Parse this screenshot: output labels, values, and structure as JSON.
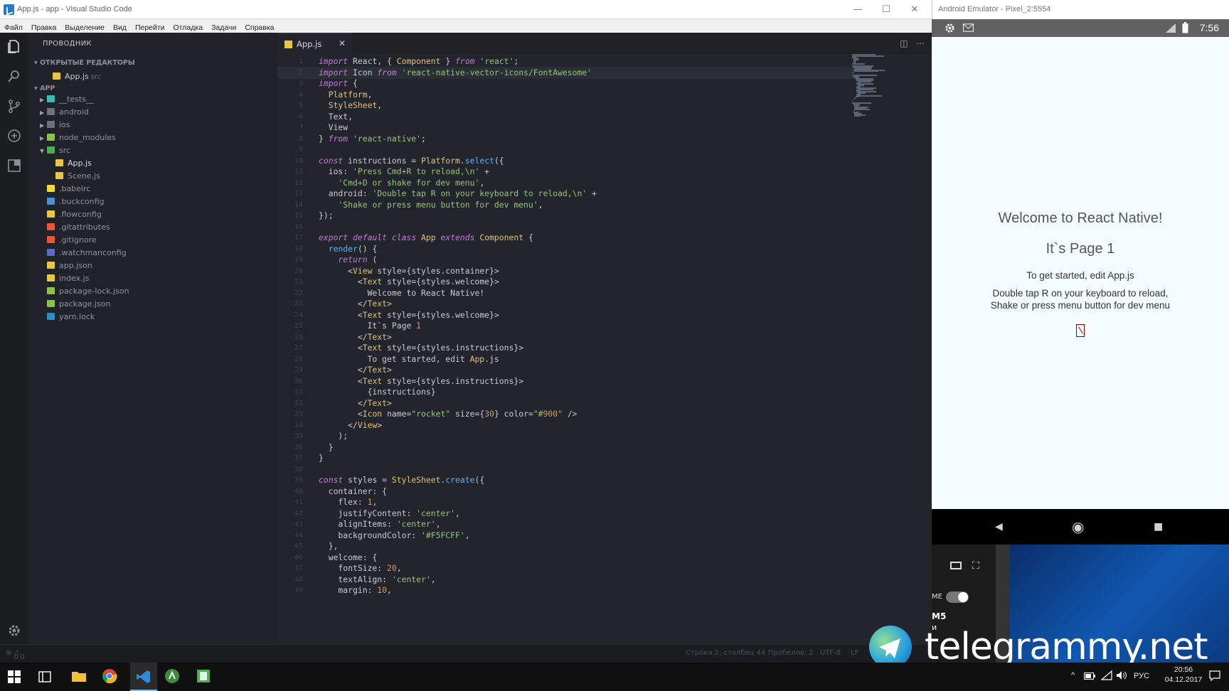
{
  "vscode": {
    "window_title": "App.js - app - Visual Studio Code",
    "menu": [
      "Файл",
      "Правка",
      "Выделение",
      "Вид",
      "Перейти",
      "Отладка",
      "Задачи",
      "Справка"
    ],
    "explorer_title": "ПРОВОДНИК",
    "open_editors_label": "ОТКРЫТЫЕ РЕДАКТОРЫ",
    "open_editor_file": "App.js",
    "open_editor_folder": "src",
    "project_label": "APP",
    "tree": [
      {
        "label": "__tests__",
        "icon": "tests-folder-icon",
        "color": "#3dbcb0"
      },
      {
        "label": "android",
        "icon": "folder-icon",
        "color": "#6b7380"
      },
      {
        "label": "ios",
        "icon": "folder-icon",
        "color": "#6b7380"
      },
      {
        "label": "node_modules",
        "icon": "node-folder-icon",
        "color": "#8bc34a"
      },
      {
        "label": "src",
        "icon": "src-folder-icon",
        "color": "#4caf50"
      },
      {
        "label": "App.js",
        "icon": "js-file-icon",
        "color": "#e7c547"
      },
      {
        "label": "Scene.js",
        "icon": "js-file-icon",
        "color": "#e7c547"
      },
      {
        "label": ".babelrc",
        "icon": "babel-icon",
        "color": "#f5d742"
      },
      {
        "label": ".buckconfig",
        "icon": "file-icon",
        "color": "#4a90d9"
      },
      {
        "label": ".flowconfig",
        "icon": "flow-icon",
        "color": "#e7c547"
      },
      {
        "label": ".gitattributes",
        "icon": "git-icon",
        "color": "#e8563a"
      },
      {
        "label": ".gitignore",
        "icon": "git-icon",
        "color": "#e8563a"
      },
      {
        "label": ".watchmanconfig",
        "icon": "watchman-icon",
        "color": "#5c6bc0"
      },
      {
        "label": "app.json",
        "icon": "json-icon",
        "color": "#e7c547"
      },
      {
        "label": "index.js",
        "icon": "js-file-icon",
        "color": "#e7c547"
      },
      {
        "label": "package-lock.json",
        "icon": "npm-icon",
        "color": "#8bc34a"
      },
      {
        "label": "package.json",
        "icon": "npm-icon",
        "color": "#8bc34a"
      },
      {
        "label": "yarn.lock",
        "icon": "yarn-icon",
        "color": "#2c8ebb"
      }
    ],
    "tab_label": "App.js",
    "tab_close": "✕",
    "code_lines": [
      "import React, { Component } from 'react';",
      "import Icon from 'react-native-vector-icons/FontAwesome'",
      "import {",
      "  Platform,",
      "  StyleSheet,",
      "  Text,",
      "  View",
      "} from 'react-native';",
      "",
      "const instructions = Platform.select({",
      "  ios: 'Press Cmd+R to reload,\\n' +",
      "    'Cmd+D or shake for dev menu',",
      "  android: 'Double tap R on your keyboard to reload,\\n' +",
      "    'Shake or press menu button for dev menu',",
      "});",
      "",
      "export default class App extends Component {",
      "  render() {",
      "    return (",
      "      <View style={styles.container}>",
      "        <Text style={styles.welcome}>",
      "          Welcome to React Native!",
      "        </Text>",
      "        <Text style={styles.welcome}>",
      "          It`s Page 1",
      "        </Text>",
      "        <Text style={styles.instructions}>",
      "          To get started, edit App.js",
      "        </Text>",
      "        <Text style={styles.instructions}>",
      "          {instructions}",
      "        </Text>",
      "        <Icon name=\"rocket\" size={30} color=\"#900\" />",
      "      </View>",
      "    );",
      "  }",
      "}",
      "",
      "const styles = StyleSheet.create({",
      "  container: {",
      "    flex: 1,",
      "    justifyContent: 'center',",
      "    alignItems: 'center',",
      "    backgroundColor: '#F5FCFF',",
      "  },",
      "  welcome: {",
      "    fontSize: 20,",
      "    textAlign: 'center',",
      "    margin: 10,"
    ],
    "status": {
      "problems": "0",
      "warnings": "0",
      "cursor": "Строка 2, столбец 44",
      "indent": "Пробелов: 2",
      "encoding": "UTF-8",
      "eol": "LF"
    }
  },
  "emulator": {
    "window_title": "Android Emulator - Pixel_2:5554",
    "clock": "7:56",
    "welcome": "Welcome to React Native!",
    "page": "It`s Page 1",
    "get_started": "To get started, edit App.js",
    "instructions_line1": "Double tap R on your keyboard to reload,",
    "instructions_line2": "Shake or press menu button for dev menu",
    "side_labels": [
      "ME",
      "M5",
      "и"
    ]
  },
  "watermark": "telegrammy.net",
  "taskbar": {
    "lang": "РУС",
    "time": "20:56",
    "date": "04.12.2017"
  },
  "colors": {
    "keyword": "#c678dd",
    "string": "#98c379",
    "func": "#61afef",
    "tag": "#e5c07b",
    "number": "#d19a66"
  }
}
